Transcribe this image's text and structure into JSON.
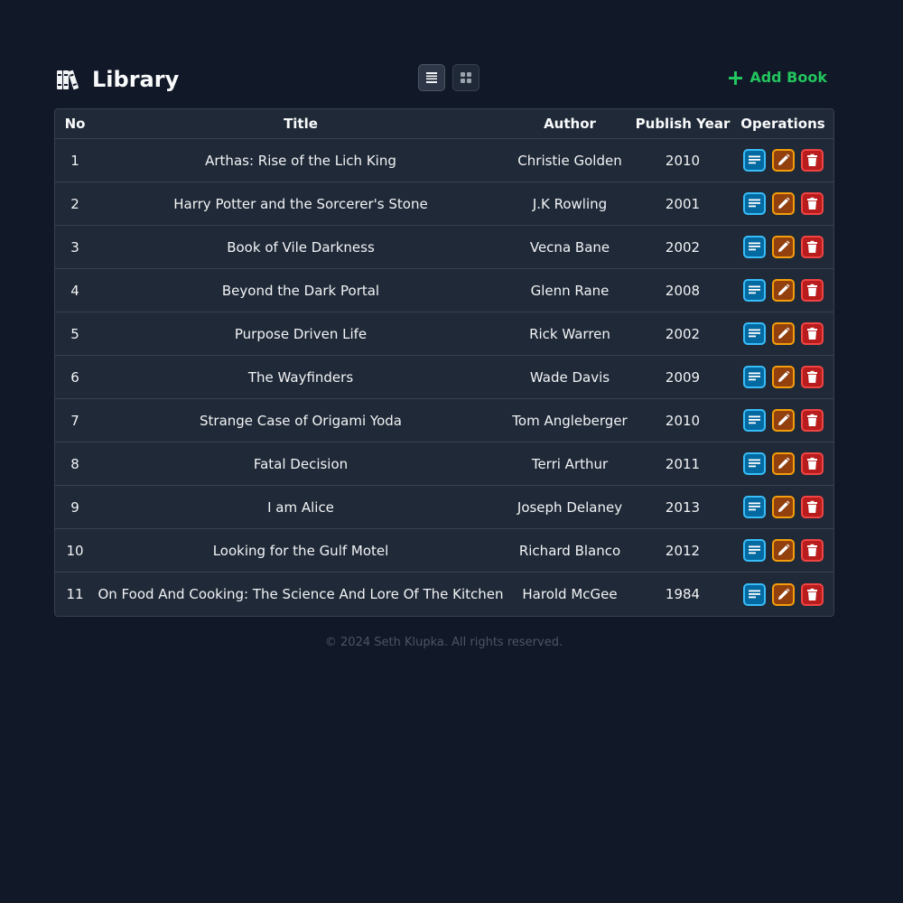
{
  "header": {
    "title": "Library",
    "brand_icon": "books-icon",
    "view_toggle": [
      {
        "icon": "list-view-icon",
        "active": true
      },
      {
        "icon": "grid-view-icon",
        "active": false
      }
    ],
    "add_button": {
      "label": "Add Book",
      "icon": "plus-icon",
      "color": "#22c55e"
    }
  },
  "table": {
    "columns": [
      "No",
      "Title",
      "Author",
      "Publish Year",
      "Operations"
    ],
    "rows": [
      {
        "no": "1",
        "title": "Arthas: Rise of the Lich King",
        "author": "Christie Golden",
        "year": "2010"
      },
      {
        "no": "2",
        "title": "Harry Potter and the Sorcerer's Stone",
        "author": "J.K Rowling",
        "year": "2001"
      },
      {
        "no": "3",
        "title": "Book of Vile Darkness",
        "author": "Vecna Bane",
        "year": "2002"
      },
      {
        "no": "4",
        "title": "Beyond the Dark Portal",
        "author": "Glenn Rane",
        "year": "2008"
      },
      {
        "no": "5",
        "title": "Purpose Driven Life",
        "author": "Rick Warren",
        "year": "2002"
      },
      {
        "no": "6",
        "title": "The Wayfinders",
        "author": "Wade Davis",
        "year": "2009"
      },
      {
        "no": "7",
        "title": "Strange Case of Origami Yoda",
        "author": "Tom Angleberger",
        "year": "2010"
      },
      {
        "no": "8",
        "title": "Fatal Decision",
        "author": "Terri Arthur",
        "year": "2011"
      },
      {
        "no": "9",
        "title": "I am Alice",
        "author": "Joseph Delaney",
        "year": "2013"
      },
      {
        "no": "10",
        "title": "Looking for the Gulf Motel",
        "author": "Richard Blanco",
        "year": "2012"
      },
      {
        "no": "11",
        "title": "On Food And Cooking: The Science And Lore Of The Kitchen",
        "author": "Harold McGee",
        "year": "1984"
      }
    ],
    "operations": [
      {
        "name": "details",
        "icon": "details-icon",
        "color": "#0ea5e9"
      },
      {
        "name": "edit",
        "icon": "pencil-icon",
        "color": "#f59e0b"
      },
      {
        "name": "delete",
        "icon": "trash-icon",
        "color": "#ef4444"
      }
    ]
  },
  "footer": {
    "text": "© 2024 Seth Klupka. All rights reserved."
  }
}
